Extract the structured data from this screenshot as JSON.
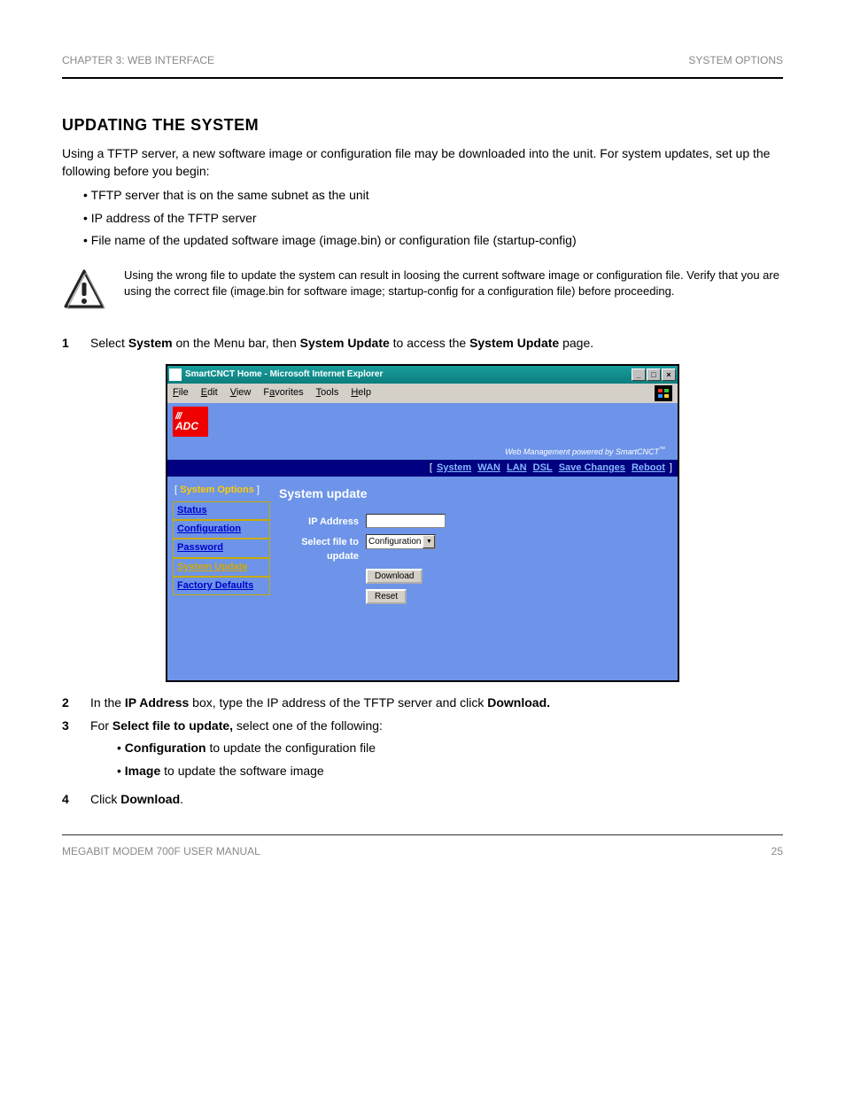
{
  "header": {
    "left": "CHAPTER 3: WEB INTERFACE",
    "right": "SYSTEM OPTIONS"
  },
  "section": {
    "title": "UPDATING THE SYSTEM",
    "intro": "Using a TFTP server, a new software image or configuration file may be downloaded into the unit. For system updates, set up the following before you begin:",
    "prereq": [
      "TFTP server that is on the same subnet as the unit",
      "IP address of the TFTP server",
      "File name of the updated software image (image.bin) or configuration file (startup-config)"
    ],
    "caution": "Using the wrong file to update the system can result in loosing the current software image or configuration file. Verify that you are using the correct file (image.bin for software image; startup-config for a configuration file) before proceeding.",
    "step1_a": "Select ",
    "step1_b": "System",
    "step1_c": " on the Menu bar, then ",
    "step1_d": "System Update",
    "step1_e": " to access the ",
    "step1_f": "System Update",
    "step1_g": " page.",
    "step2_a": "In the ",
    "step2_b": "IP Address",
    "step2_c": " box, type the IP address of the TFTP server and click ",
    "step2_d": "Download",
    "step2_e": ".",
    "step3_a": "For ",
    "step3_b": "Select file to update,",
    "step3_c": " select one of the following:",
    "step3_opt1_a": "Configuration",
    "step3_opt1_b": " to update the configuration file",
    "step3_opt2_a": "Image",
    "step3_opt2_b": " to update the software image",
    "step4_a": "Click ",
    "step4_b": "Download",
    "step4_c": "."
  },
  "browser": {
    "title": "SmartCNCT Home - Microsoft Internet Explorer",
    "menus": {
      "file": "File",
      "edit": "Edit",
      "view": "View",
      "favs": "Favorites",
      "tools": "Tools",
      "help": "Help"
    },
    "logo_top": "///",
    "logo_bot": "ADC",
    "tagline": "Web Management powered by SmartCNCT",
    "nav": {
      "system": "System",
      "wan": "WAN",
      "lan": "LAN",
      "dsl": "DSL",
      "save": "Save Changes",
      "reboot": "Reboot"
    },
    "sidebar_title": "System Options",
    "sidebar": {
      "status": "Status",
      "config": "Configuration",
      "password": "Password",
      "update": "System Update",
      "factory": "Factory Defaults"
    },
    "panel_title": "System update",
    "form": {
      "ip_label": "IP Address",
      "file_label": "Select file to update",
      "select_value": "Configuration",
      "download": "Download",
      "reset": "Reset"
    }
  },
  "footer": {
    "left": "MEGABIT MODEM 700F USER MANUAL",
    "right": "25"
  }
}
